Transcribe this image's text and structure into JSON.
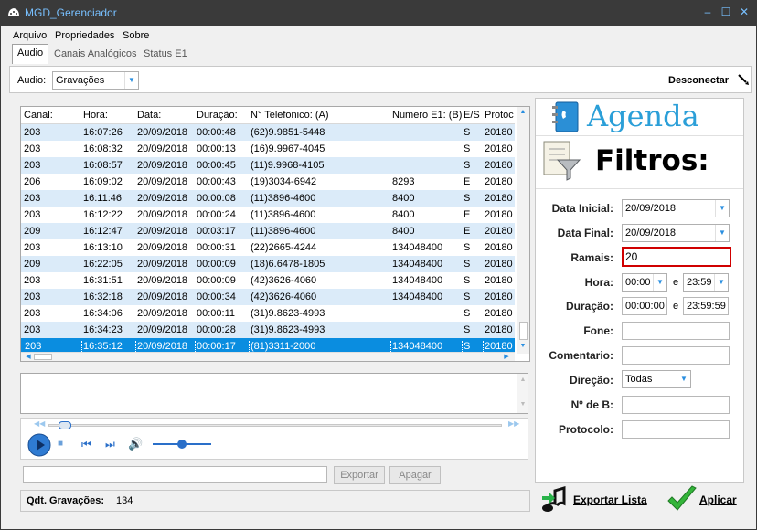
{
  "window": {
    "title": "MGD_Gerenciador"
  },
  "menu": [
    "Arquivo",
    "Propriedades",
    "Sobre"
  ],
  "tabs": [
    "Audio",
    "Canais Analógicos",
    "Status E1"
  ],
  "toolbar": {
    "audio_label": "Audio:",
    "audio_value": "Gravações",
    "disconnect_label": "Desconectar"
  },
  "grid": {
    "columns": [
      "Canal:",
      "Hora:",
      "Data:",
      "Duração:",
      "N° Telefonico: (A)",
      "Numero E1: (B)",
      "E/S",
      "Protoc"
    ],
    "rows": [
      [
        "203",
        "16:07:26",
        "20/09/2018",
        "00:00:48",
        "(62)9.9851-5448",
        "",
        "S",
        "20180"
      ],
      [
        "203",
        "16:08:32",
        "20/09/2018",
        "00:00:13",
        "(16)9.9967-4045",
        "",
        "S",
        "20180"
      ],
      [
        "203",
        "16:08:57",
        "20/09/2018",
        "00:00:45",
        "(11)9.9968-4105",
        "",
        "S",
        "20180"
      ],
      [
        "206",
        "16:09:02",
        "20/09/2018",
        "00:00:43",
        "(19)3034-6942",
        "8293",
        "E",
        "20180"
      ],
      [
        "203",
        "16:11:46",
        "20/09/2018",
        "00:00:08",
        "(11)3896-4600",
        "8400",
        "S",
        "20180"
      ],
      [
        "203",
        "16:12:22",
        "20/09/2018",
        "00:00:24",
        "(11)3896-4600",
        "8400",
        "E",
        "20180"
      ],
      [
        "209",
        "16:12:47",
        "20/09/2018",
        "00:03:17",
        "(11)3896-4600",
        "8400",
        "E",
        "20180"
      ],
      [
        "203",
        "16:13:10",
        "20/09/2018",
        "00:00:31",
        "(22)2665-4244",
        "134048400",
        "S",
        "20180"
      ],
      [
        "209",
        "16:22:05",
        "20/09/2018",
        "00:00:09",
        "(18)6.6478-1805",
        "134048400",
        "S",
        "20180"
      ],
      [
        "203",
        "16:31:51",
        "20/09/2018",
        "00:00:09",
        "(42)3626-4060",
        "134048400",
        "S",
        "20180"
      ],
      [
        "203",
        "16:32:18",
        "20/09/2018",
        "00:00:34",
        "(42)3626-4060",
        "134048400",
        "S",
        "20180"
      ],
      [
        "203",
        "16:34:06",
        "20/09/2018",
        "00:00:11",
        "(31)9.8623-4993",
        "",
        "S",
        "20180"
      ],
      [
        "203",
        "16:34:23",
        "20/09/2018",
        "00:00:28",
        "(31)9.8623-4993",
        "",
        "S",
        "20180"
      ],
      [
        "203",
        "16:35:12",
        "20/09/2018",
        "00:00:17",
        "(81)3311-2000",
        "134048400",
        "S",
        "20180"
      ]
    ],
    "selected_row": 13
  },
  "buttons": {
    "exportar": "Exportar",
    "apagar": "Apagar"
  },
  "status": {
    "label": "Qdt. Gravações:",
    "count": "134"
  },
  "agenda": {
    "title": "Agenda",
    "filters_title": "Filtros:",
    "fields": {
      "data_inicial": {
        "label": "Data Inicial:",
        "value": "20/09/2018"
      },
      "data_final": {
        "label": "Data Final:",
        "value": "20/09/2018"
      },
      "ramais": {
        "label": "Ramais:",
        "value": "20"
      },
      "hora": {
        "label": "Hora:",
        "from": "00:00",
        "to": "23:59",
        "sep": "e"
      },
      "duracao": {
        "label": "Duração:",
        "from": "00:00:00",
        "to": "23:59:59",
        "sep": "e"
      },
      "fone": {
        "label": "Fone:",
        "value": ""
      },
      "comentario": {
        "label": "Comentario:",
        "value": ""
      },
      "direcao": {
        "label": "Direção:",
        "value": "Todas"
      },
      "n_de_b": {
        "label": "Nº de B:",
        "value": ""
      },
      "protocolo": {
        "label": "Protocolo:",
        "value": ""
      }
    }
  },
  "actions": {
    "export_list": "Exportar Lista",
    "apply": "Aplicar"
  },
  "colors": {
    "selected_row": "#0a8de0",
    "alt_row": "#dbebf9",
    "accent": "#2b9fd8",
    "highlight_border": "#d00000"
  },
  "player": {
    "progress": 0.02,
    "volume": 0.5
  }
}
